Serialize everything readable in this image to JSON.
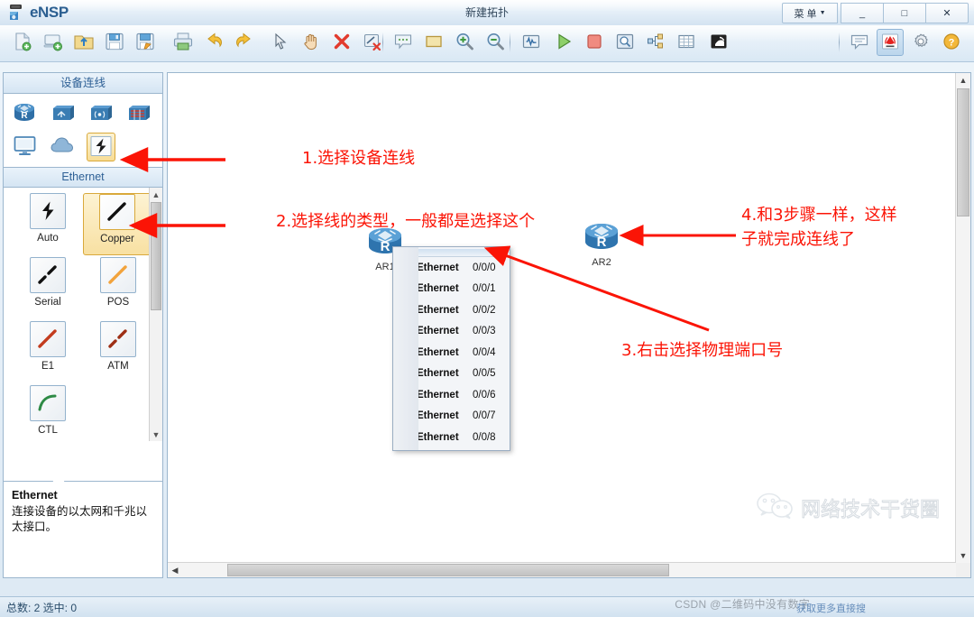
{
  "window": {
    "app_name": "eNSP",
    "title": "新建拓扑",
    "menu_label": "菜 单",
    "minimize": "_",
    "maximize": "□",
    "close": "✕"
  },
  "toolbar": {
    "buttons": [
      {
        "name": "new-topology-icon",
        "tip": "新建"
      },
      {
        "name": "new-device-icon",
        "tip": "新建设备"
      },
      {
        "name": "open-folder-icon",
        "tip": "打开"
      },
      {
        "name": "save-icon",
        "tip": "保存"
      },
      {
        "name": "save-as-icon",
        "tip": "另存为"
      },
      {
        "name": "print-icon",
        "tip": "打印"
      },
      {
        "name": "undo-icon",
        "tip": "撤销"
      },
      {
        "name": "redo-icon",
        "tip": "重做"
      },
      {
        "name": "select-pointer-icon",
        "tip": "选择"
      },
      {
        "name": "hand-pan-icon",
        "tip": "移动"
      },
      {
        "name": "delete-icon",
        "tip": "删除"
      },
      {
        "name": "remove-link-icon",
        "tip": "删除连线"
      },
      {
        "name": "comment-icon",
        "tip": "注释"
      },
      {
        "name": "rectangle-icon",
        "tip": "矩形"
      },
      {
        "name": "zoom-in-icon",
        "tip": "放大"
      },
      {
        "name": "zoom-out-icon",
        "tip": "缩小"
      },
      {
        "name": "capture-packet-icon",
        "tip": "数据抓包"
      },
      {
        "name": "start-all-icon",
        "tip": "开启设备"
      },
      {
        "name": "stop-all-icon",
        "tip": "关闭设备"
      },
      {
        "name": "search-device-icon",
        "tip": "查找设备"
      },
      {
        "name": "topology-tree-icon",
        "tip": "拓扑树"
      },
      {
        "name": "grid-icon",
        "tip": "网格"
      },
      {
        "name": "screenshot-icon",
        "tip": "截图"
      },
      {
        "name": "feedback-icon",
        "tip": "反馈"
      },
      {
        "name": "huawei-icon",
        "tip": "华为"
      },
      {
        "name": "settings-gear-icon",
        "tip": "设置"
      },
      {
        "name": "help-icon",
        "tip": "帮助"
      }
    ]
  },
  "sidebar": {
    "device_panel_title": "设备连线",
    "device_rows": [
      [
        {
          "name": "router-category-icon",
          "label": "路由器",
          "selected": false
        },
        {
          "name": "switch-category-icon",
          "label": "交换机",
          "selected": false
        },
        {
          "name": "wlan-category-icon",
          "label": "无线局域网",
          "selected": false
        },
        {
          "name": "firewall-category-icon",
          "label": "防火墙",
          "selected": false
        }
      ],
      [
        {
          "name": "terminal-category-icon",
          "label": "终端",
          "selected": false
        },
        {
          "name": "cloud-category-icon",
          "label": "其他设备",
          "selected": false
        },
        {
          "name": "connection-category-icon",
          "label": "设备连线",
          "selected": true
        }
      ]
    ],
    "cable_panel_title": "Ethernet",
    "cables": [
      {
        "label": "Auto",
        "icon": "auto-cable-icon",
        "selected": false
      },
      {
        "label": "Copper",
        "icon": "copper-cable-icon",
        "selected": true
      },
      {
        "label": "Serial",
        "icon": "serial-cable-icon",
        "selected": false
      },
      {
        "label": "POS",
        "icon": "pos-cable-icon",
        "selected": false
      },
      {
        "label": "E1",
        "icon": "e1-cable-icon",
        "selected": false
      },
      {
        "label": "ATM",
        "icon": "atm-cable-icon",
        "selected": false
      },
      {
        "label": "CTL",
        "icon": "ctl-cable-icon",
        "selected": false
      }
    ],
    "description": {
      "title": "Ethernet",
      "body": "连接设备的以太网和千兆以太接口。"
    }
  },
  "canvas": {
    "devices": [
      {
        "name": "router-ar1",
        "label": "AR1"
      },
      {
        "name": "router-ar2",
        "label": "AR2"
      }
    ],
    "context_menu": {
      "port_label": "Ethernet",
      "ports": [
        "0/0/0",
        "0/0/1",
        "0/0/2",
        "0/0/3",
        "0/0/4",
        "0/0/5",
        "0/0/6",
        "0/0/7",
        "0/0/8"
      ]
    },
    "annotations": [
      {
        "id": "step1",
        "text": "1.选择设备连线"
      },
      {
        "id": "step2",
        "text": "2.选择线的类型，一般都是选择这个"
      },
      {
        "id": "step3",
        "text": "3.右击选择物理端口号"
      },
      {
        "id": "step4line1",
        "text": "4.和3步骤一样，这样"
      },
      {
        "id": "step4line2",
        "text": "子就完成连线了"
      }
    ]
  },
  "statusbar": {
    "text": "总数: 2  选中: 0"
  },
  "watermark": {
    "text": "网络技术干货圈",
    "csdn": "CSDN @二维码中没有数字",
    "overlay": "获取更多直接搜"
  },
  "colors": {
    "annotation_red": "#fb1406",
    "accent_blue": "#2f6196",
    "selection_gold": "#d9a93b",
    "router_blue": "#2f80c4"
  }
}
